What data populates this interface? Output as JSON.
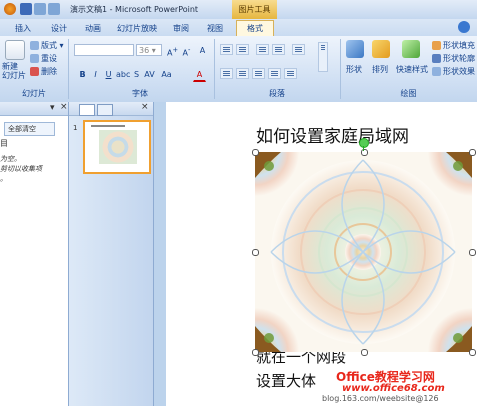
{
  "window": {
    "title": "演示文稿1 - Microsoft PowerPoint",
    "context_tab": "图片工具"
  },
  "tabs": [
    "插入",
    "设计",
    "动画",
    "幻灯片放映",
    "审阅",
    "视图",
    "格式"
  ],
  "ribbon": {
    "slides_group": {
      "new_slide": "新建\n幻灯片",
      "layout": "版式",
      "reset": "重设",
      "delete": "删除",
      "label": "幻灯片"
    },
    "font_group": {
      "font_size": "36",
      "label": "字体"
    },
    "paragraph_group": {
      "label": "段落"
    },
    "drawing_group": {
      "shapes": "形状",
      "arrange": "排列",
      "quick_styles": "快速样式",
      "fill": "形状填充",
      "outline": "形状轮廓",
      "effects": "形状效果",
      "label": "绘图"
    }
  },
  "outline_pane": {
    "search_button": "全部清空",
    "label_char": "目",
    "lines": [
      "为空。",
      "剪切以收集项",
      "。"
    ]
  },
  "slides_pane": {
    "slide_number": "1"
  },
  "slide": {
    "title": "如何设置家庭局域网",
    "line1": "就在一个网段",
    "line2": "设置大体"
  },
  "watermark": {
    "brand": "Office教程学习网",
    "url": "www.office68.com",
    "blog": "blog.163.com/weebsite@126"
  },
  "colors": {
    "accent": "#15428b",
    "context_tab": "#e6b640",
    "ribbon": "#cfdff3"
  }
}
